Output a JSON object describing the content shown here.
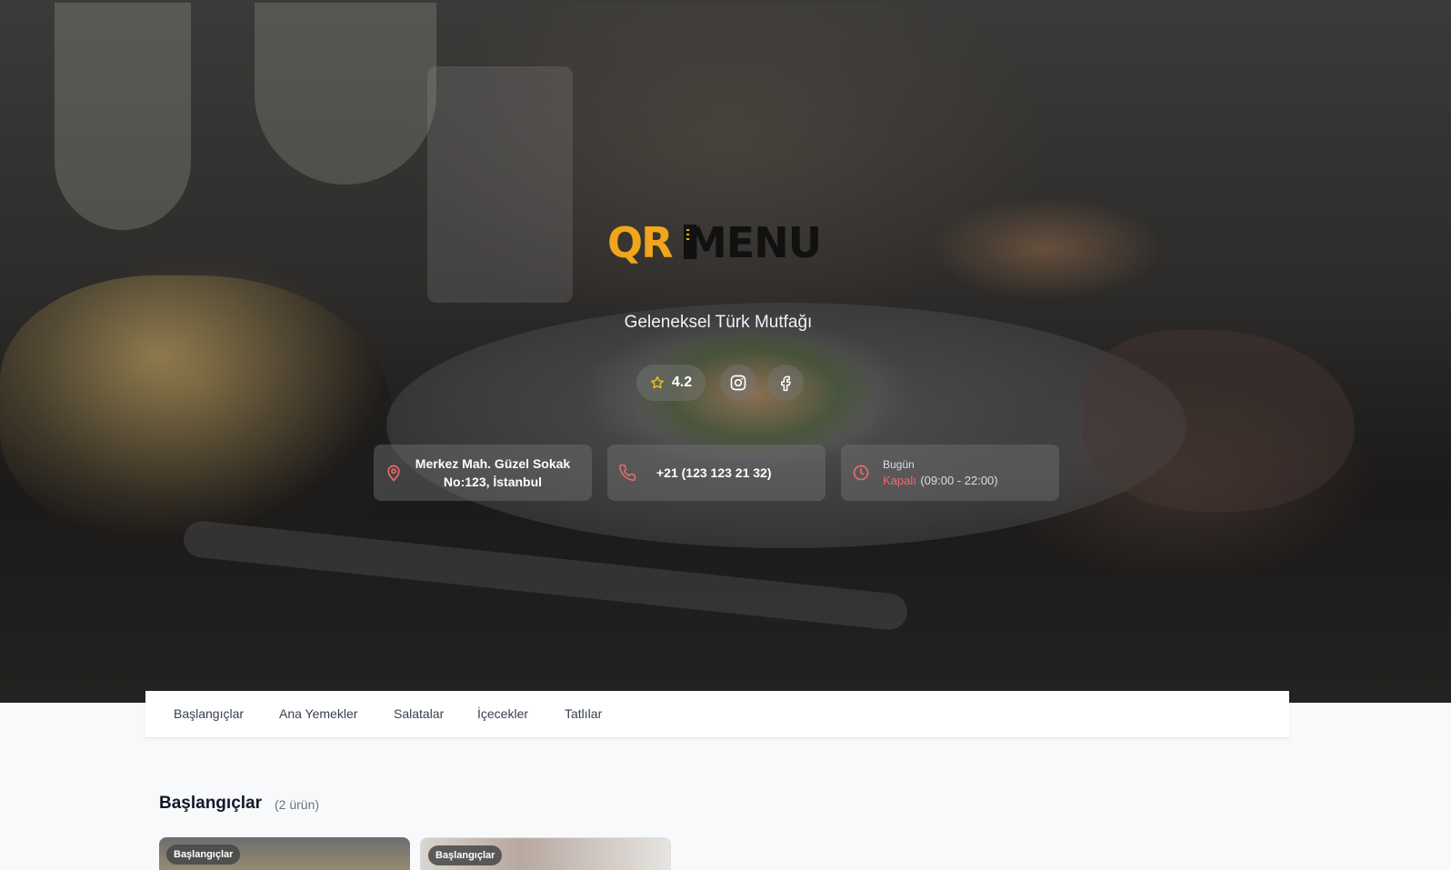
{
  "hero": {
    "logo_qr": "QR",
    "logo_menu": "MENU",
    "tagline": "Geleneksel Türk Mutfağı",
    "rating": "4.2",
    "address_line1": "Merkez Mah. Güzel Sokak",
    "address_line2": "No:123, İstanbul",
    "phone": "+21 (123 123 21 32)",
    "hours_label": "Bugün",
    "hours_status": "Kapalı",
    "hours_range": "(09:00 - 22:00)"
  },
  "nav": {
    "tabs": [
      "Başlangıçlar",
      "Ana Yemekler",
      "Salatalar",
      "İçecekler",
      "Tatlılar"
    ]
  },
  "section": {
    "title": "Başlangıçlar",
    "count": "(2 ürün)",
    "items": [
      {
        "category": "Başlangıçlar"
      },
      {
        "category": "Başlangıçlar"
      }
    ]
  },
  "colors": {
    "brand_yellow": "#f0a51c",
    "closed_red": "#ef6a6a",
    "star_yellow": "#f5c518"
  },
  "icons": [
    "star-icon",
    "instagram-icon",
    "facebook-icon",
    "location-pin-icon",
    "phone-icon",
    "clock-icon"
  ]
}
